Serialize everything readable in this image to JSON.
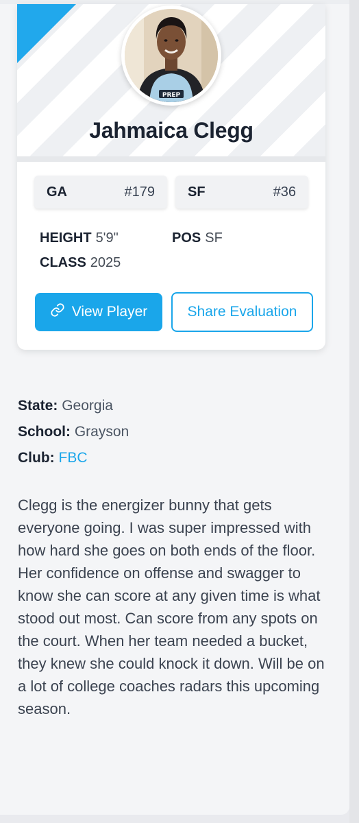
{
  "player": {
    "name": "Jahmaica Clegg",
    "state_rank": {
      "label": "GA",
      "value": "#179"
    },
    "position_rank": {
      "label": "SF",
      "value": "#36"
    },
    "height_label": "HEIGHT",
    "height": "5'9\"",
    "position_label": "POS",
    "position": "SF",
    "class_label": "CLASS",
    "class_year": "2025",
    "jersey_text": "PREP"
  },
  "actions": {
    "view_player": "View Player",
    "share_evaluation": "Share Evaluation"
  },
  "details": {
    "state_label": "State:",
    "state": "Georgia",
    "school_label": "School:",
    "school": "Grayson",
    "club_label": "Club:",
    "club": "FBC"
  },
  "evaluation": "Clegg is the energizer bunny that gets everyone going. I was super impressed with how hard she goes on both ends of the floor. Her confidence on offense and swagger to know she can score at any given time is what stood out most. Can score from any spots on the court. When her team needed a bucket, they knew she could knock it down. Will be on a lot of college coaches radars this upcoming season.",
  "colors": {
    "accent": "#1aa6ea",
    "heading": "#1b2331",
    "body_text": "#3b4350",
    "page_bg": "#f4f5f7"
  },
  "icons": {
    "view_player_button": "link-icon"
  }
}
